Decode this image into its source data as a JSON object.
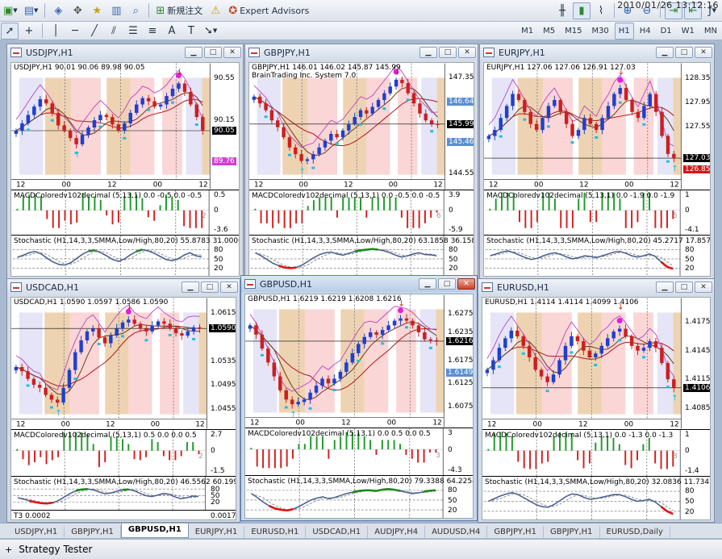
{
  "clock": "2010/01/26 13:12:16",
  "toolbar": {
    "new_order_label": "新規注文",
    "expert_advisors_label": "Expert Advisors",
    "timeframes": [
      "M1",
      "M5",
      "M15",
      "M30",
      "H1",
      "H4",
      "D1",
      "W1",
      "MN"
    ],
    "active_timeframe": "H1"
  },
  "indicator_labels": {
    "macd": "MACDColoredv102decimal (5,13,1)",
    "stochastic": "Stochastic (H1,14,3,3,SMMA,Low/High,80,20)"
  },
  "charts": [
    {
      "title": "USDJPY,H1",
      "ohlc": "USDJPY,H1  90.01 90.06 89.98 90.05",
      "prices": [
        "90.55",
        "90.15",
        "89.75"
      ],
      "current_price": "90.05",
      "ref_price": "89.76",
      "time_labels": [
        "12",
        "00",
        "12",
        "00",
        "12"
      ],
      "macd": "MACDColoredv102decimal (5,13,1) 0.0 -0.5 0.0 -0.5",
      "macd_scale": [
        "0.5",
        "0",
        "-3.6"
      ],
      "macd_digit": "2",
      "stoch": "Stochastic (H1,14,3,3,SMMA,Low/High,80,20) 55.8783 31.0000",
      "stoch_scale": [
        "80",
        "50",
        "20"
      ],
      "closes": [
        90.05,
        90.12,
        90.2,
        90.28,
        90.35,
        90.31,
        90.22,
        90.1,
        90.05,
        89.98,
        89.92,
        90.01,
        90.08,
        90.15,
        90.2,
        90.18,
        90.11,
        90.05,
        90.12,
        90.22,
        90.3,
        90.36,
        90.33,
        90.28,
        90.3,
        90.38,
        90.45,
        90.5,
        90.42,
        90.3,
        90.18,
        90.05
      ],
      "ylim": [
        89.6,
        90.6
      ],
      "stoch_values": [
        55,
        62,
        70,
        74,
        66,
        52,
        40,
        32,
        30,
        38,
        52,
        66,
        75,
        78,
        70,
        60,
        48,
        42,
        50,
        63,
        74,
        80,
        76,
        68,
        58,
        48,
        44,
        50,
        62,
        70,
        60,
        56
      ]
    },
    {
      "title": "GBPJPY,H1",
      "ohlc": "GBPJPY,H1  146.01 146.02 145.87 145.99",
      "subtitle": "BrainTrading Inc. System 7.0",
      "prices": [
        "147.35",
        "146.64",
        "145.99",
        "145.46",
        "144.55"
      ],
      "current_price": "145.99",
      "ref_price": "146.64",
      "ref_price2": "145.46",
      "time_labels": [
        "12",
        "00",
        "12",
        "00",
        "12"
      ],
      "macd": "MACDColoredv102decimal (5,13,1) 0.0 -0.5 0.0 -0.5",
      "macd_scale": [
        "3.9",
        "0",
        "-5.9"
      ],
      "macd_digit": "6",
      "stoch": "Stochastic (H1,14,3,3,SMMA,Low/High,80,20) 63.1858 36.1587",
      "stoch_scale": [
        "80",
        "50",
        "20"
      ],
      "closes": [
        146.8,
        146.6,
        146.4,
        146.1,
        145.9,
        145.6,
        145.3,
        145.1,
        144.9,
        144.95,
        145.1,
        145.3,
        145.5,
        145.7,
        145.6,
        145.8,
        146.0,
        146.2,
        146.4,
        146.3,
        146.5,
        146.7,
        146.9,
        147.1,
        147.3,
        147.2,
        146.9,
        146.6,
        146.3,
        146.1,
        146.0,
        145.99
      ],
      "ylim": [
        144.4,
        147.5
      ],
      "stoch_values": [
        70,
        60,
        48,
        36,
        28,
        22,
        20,
        22,
        30,
        42,
        54,
        64,
        70,
        72,
        66,
        62,
        68,
        74,
        78,
        80,
        82,
        80,
        76,
        70,
        62,
        56,
        60,
        66,
        70,
        64,
        63,
        60
      ]
    },
    {
      "title": "EURJPY,H1",
      "ohlc": "EURJPY,H1  127.06 127.06 126.91 127.03",
      "prices": [
        "128.35",
        "127.95",
        "127.55",
        "127.03",
        "126.85"
      ],
      "current_price": "127.03",
      "ref_price": "126.85",
      "time_labels": [
        "12",
        "00",
        "12",
        "00",
        "12"
      ],
      "macd": "MACDColoredv102decimal (5,13,1) 0.0 -1.9 0.0 -1.9",
      "macd_scale": [
        "1",
        "0",
        "-4.1"
      ],
      "macd_digit": "5",
      "stoch": "Stochastic (H1,14,3,3,SMMA,Low/High,80,20) 45.2717 17.8577",
      "stoch_scale": [
        "80",
        "50",
        "20"
      ],
      "closes": [
        127.4,
        127.5,
        127.7,
        127.9,
        128.1,
        128.0,
        127.8,
        127.6,
        127.5,
        127.7,
        127.9,
        128.0,
        127.8,
        127.6,
        127.4,
        127.5,
        127.7,
        127.6,
        127.5,
        127.7,
        127.9,
        128.1,
        128.2,
        128.0,
        127.8,
        127.7,
        127.9,
        128.1,
        127.8,
        127.4,
        127.1,
        127.03
      ],
      "ylim": [
        126.7,
        128.45
      ],
      "stoch_values": [
        60,
        66,
        72,
        76,
        70,
        62,
        54,
        48,
        52,
        60,
        66,
        70,
        64,
        56,
        50,
        54,
        60,
        58,
        54,
        60,
        66,
        72,
        74,
        68,
        60,
        56,
        60,
        66,
        58,
        40,
        24,
        18
      ]
    },
    {
      "title": "USDCAD,H1",
      "ohlc": "USDCAD,H1  1.0590 1.0597 1.0586 1.0590",
      "prices": [
        "1.0615",
        "1.0590",
        "1.0535",
        "1.0495",
        "1.0455"
      ],
      "current_price": "1.0590",
      "time_labels": [
        "12",
        "00",
        "12",
        "00",
        "12"
      ],
      "macd": "MACDColoredv102decimal (5,13,1) 0.5 0.0 0.0 0.5",
      "macd_scale": [
        "2.7",
        "0",
        "-1.5"
      ],
      "macd_digit": "2",
      "stoch": "Stochastic (H1,14,3,3,SMMA,Low/High,80,20) 46.5562 60.1990",
      "stoch_scale": [
        "80",
        "50",
        "20"
      ],
      "extra_label": "T3 0.0002",
      "extra_scale": "0.0017",
      "closes": [
        1.0525,
        1.0518,
        1.0505,
        1.0495,
        1.049,
        1.0478,
        1.047,
        1.0465,
        1.049,
        1.052,
        1.055,
        1.057,
        1.0585,
        1.059,
        1.0575,
        1.0565,
        1.0578,
        1.059,
        1.06,
        1.0605,
        1.0598,
        1.059,
        1.0585,
        1.0595,
        1.0602,
        1.0598,
        1.059,
        1.0582,
        1.0578,
        1.0585,
        1.0592,
        1.059
      ],
      "ylim": [
        1.044,
        1.0625
      ],
      "stoch_values": [
        40,
        34,
        26,
        20,
        16,
        14,
        18,
        28,
        44,
        60,
        72,
        78,
        80,
        76,
        66,
        58,
        62,
        70,
        76,
        78,
        72,
        60,
        50,
        46,
        52,
        60,
        56,
        44,
        36,
        40,
        48,
        46
      ]
    },
    {
      "title": "GBPUSD,H1",
      "ohlc": "GBPUSD,H1  1.6219 1.6219 1.6208 1.6216",
      "prices": [
        "1.6275",
        "1.6235",
        "1.6216",
        "1.6175",
        "1.6149",
        "1.6125",
        "1.6075"
      ],
      "current_price": "1.6216",
      "ref_price": "1.6149",
      "time_labels": [
        "12",
        "00",
        "12",
        "00",
        "12"
      ],
      "macd": "MACDColoredv102decimal (5,13,1) 0.0 0.5 0.0 0.5",
      "macd_scale": [
        "3",
        "0",
        "-4.3"
      ],
      "macd_digit": "3",
      "stoch": "Stochastic (H1,14,3,3,SMMA,Low/High,80,20) 79.3388 64.2254",
      "stoch_scale": [
        "80",
        "50",
        "20"
      ],
      "closes": [
        1.625,
        1.623,
        1.62,
        1.617,
        1.614,
        1.611,
        1.609,
        1.608,
        1.6085,
        1.609,
        1.6105,
        1.612,
        1.6135,
        1.6125,
        1.6135,
        1.615,
        1.617,
        1.619,
        1.621,
        1.6225,
        1.6235,
        1.623,
        1.624,
        1.625,
        1.626,
        1.6265,
        1.626,
        1.625,
        1.6235,
        1.622,
        1.6218,
        1.6216
      ],
      "ylim": [
        1.6055,
        1.6295
      ],
      "stoch_values": [
        70,
        58,
        44,
        32,
        24,
        20,
        18,
        22,
        30,
        40,
        50,
        56,
        60,
        54,
        58,
        64,
        70,
        74,
        78,
        80,
        80,
        78,
        82,
        84,
        82,
        78,
        74,
        70,
        72,
        76,
        79,
        80
      ]
    },
    {
      "title": "EURUSD,H1",
      "ohlc": "EURUSD,H1  1.4114 1.4114 1.4099 1.4106",
      "prices": [
        "1.4175",
        "1.4145",
        "1.4115",
        "1.4106",
        "1.4085"
      ],
      "current_price": "1.4106",
      "time_labels": [
        "12",
        "00",
        "12",
        "00",
        "12"
      ],
      "macd": "MACDColoredv102decimal (5,13,1) 0.0 -1.3 0.0 -1.3",
      "macd_scale": [
        "1",
        "0",
        "-1.4"
      ],
      "macd_digit": "3",
      "stoch": "Stochastic (H1,14,3,3,SMMA,Low/High,80,20) 32.0836 11.7347",
      "stoch_scale": [
        "80",
        "50",
        "20"
      ],
      "closes": [
        1.4125,
        1.4135,
        1.4148,
        1.4158,
        1.4166,
        1.416,
        1.415,
        1.4138,
        1.4125,
        1.4118,
        1.4112,
        1.412,
        1.4135,
        1.415,
        1.416,
        1.4155,
        1.4145,
        1.4138,
        1.4142,
        1.415,
        1.4158,
        1.4165,
        1.4168,
        1.416,
        1.415,
        1.4145,
        1.4148,
        1.4155,
        1.4148,
        1.4132,
        1.4115,
        1.4106
      ],
      "ylim": [
        1.4075,
        1.419
      ],
      "stoch_values": [
        50,
        58,
        66,
        72,
        76,
        70,
        60,
        50,
        40,
        34,
        32,
        40,
        52,
        64,
        72,
        70,
        62,
        56,
        58,
        62,
        66,
        70,
        70,
        64,
        56,
        50,
        52,
        56,
        48,
        34,
        20,
        12
      ]
    }
  ],
  "tabs": [
    "USDJPY,H1",
    "GBPJPY,H1",
    "GBPUSD,H1",
    "EURJPY,H1",
    "EURUSD,H1",
    "USDCAD,H1",
    "AUDJPY,H4",
    "AUDUSD,H4",
    "GBPJPY,H1",
    "GBPJPY,H1",
    "EURUSD,Daily"
  ],
  "active_tab": "GBPUSD,H1",
  "status": {
    "strategy_tester": "Strategy Tester"
  },
  "colors": {
    "up": "#1f3fcf",
    "down": "#cc1f1f",
    "ma1": "#b01818",
    "ma2": "#6b3b1a",
    "band": "#c040c0",
    "stop": "#22bde0",
    "macd_up": "#1f9b2a",
    "macd_down": "#d42020",
    "stoch_main": "#4a6090",
    "stoch_hot": "#e01010",
    "zone_pink": "#f8c8c8",
    "zone_tan": "#e8c49a",
    "zone_lav": "#dcdcf4"
  }
}
